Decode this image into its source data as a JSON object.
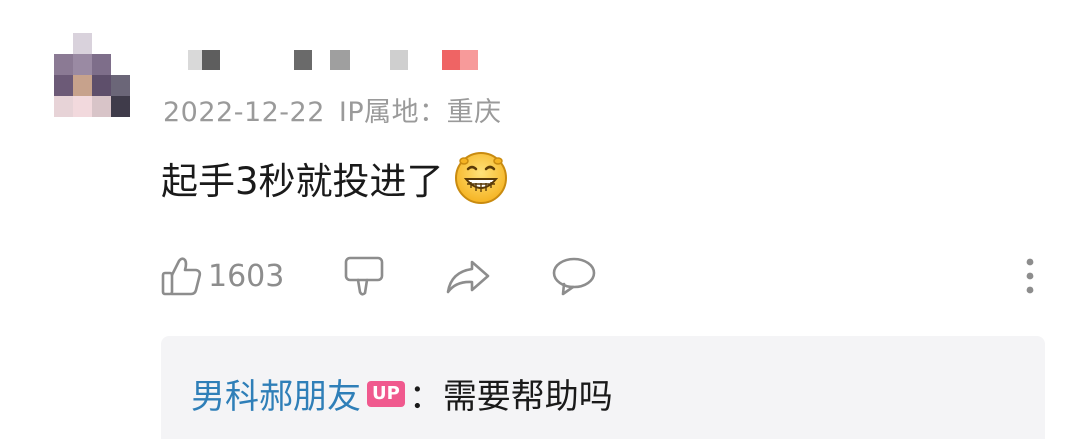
{
  "comment": {
    "date": "2022-12-22",
    "ip_location": "IP属地：重庆",
    "text": "起手3秒就投进了",
    "emoji": "grinning-face",
    "like_count": "1603"
  },
  "reply": {
    "user": "男科郝朋友",
    "badge": "UP",
    "separator": "：",
    "text": "需要帮助吗"
  },
  "colors": {
    "reply_user": "#2f7fb8",
    "up_badge": "#f0598e",
    "meta_text": "#9a9a9a",
    "icon_gray": "#8d8d8d",
    "reply_bg": "#f4f4f6"
  }
}
